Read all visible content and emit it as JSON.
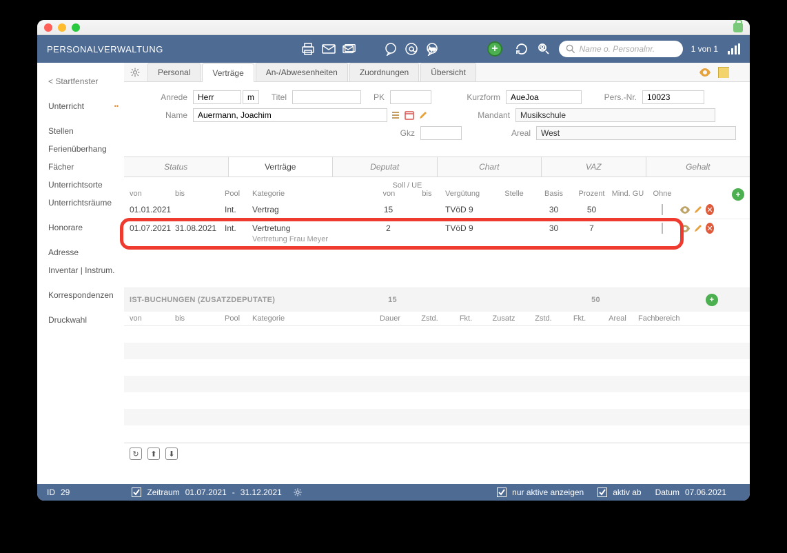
{
  "app": {
    "title": "PERSONALVERWALTUNG",
    "search_placeholder": "Name o. Personalnr.",
    "page_info": "1 von 1"
  },
  "tabs": {
    "items": [
      "Personal",
      "Verträge",
      "An-/Abwesenheiten",
      "Zuordnungen",
      "Übersicht"
    ],
    "active": 1
  },
  "sidebar": {
    "back": "< Startfenster",
    "items": [
      "Unterricht",
      "Stellen",
      "Ferienüberhang",
      "Fächer",
      "Unterrichtsorte",
      "Unterrichtsräume",
      "Honorare",
      "Adresse",
      "Inventar | Instrum.",
      "Korrespondenzen",
      "Druckwahl"
    ]
  },
  "form": {
    "anrede_label": "Anrede",
    "anrede": "Herr",
    "gender": "m",
    "titel_label": "Titel",
    "titel": "",
    "pk_label": "PK",
    "pk": "",
    "name_label": "Name",
    "name": "Auermann, Joachim",
    "gkz_label": "Gkz",
    "gkz": "",
    "kurzform_label": "Kurzform",
    "kurzform": "AueJoa",
    "persnr_label": "Pers.-Nr.",
    "persnr": "10023",
    "mandant_label": "Mandant",
    "mandant": "Musikschule",
    "areal_label": "Areal",
    "areal": "West"
  },
  "subtabs": {
    "items": [
      "Status",
      "Verträge",
      "Deputat",
      "Chart",
      "VAZ",
      "Gehalt"
    ],
    "active": 1
  },
  "contracts": {
    "headers": {
      "von": "von",
      "bis": "bis",
      "pool": "Pool",
      "kategorie": "Kategorie",
      "soll": "Soll / UE",
      "soll_von": "von",
      "soll_bis": "bis",
      "verguetung": "Vergütung",
      "stelle": "Stelle",
      "basis": "Basis",
      "prozent": "Prozent",
      "mindgu": "Mind. GU",
      "ohne": "Ohne"
    },
    "rows": [
      {
        "von": "01.01.2021",
        "bis": "",
        "pool": "Int.",
        "kategorie": "Vertrag",
        "soll_von": "15",
        "soll_bis": "",
        "verguetung": "TVöD 9",
        "stelle_icon": true,
        "basis": "30",
        "prozent": "50",
        "mindgu": "",
        "note": ""
      },
      {
        "von": "01.07.2021",
        "bis": "31.08.2021",
        "pool": "Int.",
        "kategorie": "Vertretung",
        "soll_von": "2",
        "soll_bis": "",
        "verguetung": "TVöD 9",
        "stelle_icon": true,
        "basis": "30",
        "prozent": "7",
        "mindgu": "",
        "note": "Vertretung Frau Meyer",
        "highlighted": true
      }
    ]
  },
  "ist": {
    "title": "IST-BUCHUNGEN (ZUSATZDEPUTATE)",
    "sum_dauer": "15",
    "sum_prozent": "50",
    "headers": {
      "von": "von",
      "bis": "bis",
      "pool": "Pool",
      "kategorie": "Kategorie",
      "dauer": "Dauer",
      "zstd": "Zstd.",
      "fkt": "Fkt.",
      "zusatz": "Zusatz",
      "zstd2": "Zstd.",
      "fkt2": "Fkt.",
      "areal": "Areal",
      "fachbereich": "Fachbereich"
    }
  },
  "footer": {
    "id_label": "ID",
    "id": "29",
    "zeitraum_label": "Zeitraum",
    "zeitraum_von": "01.07.2021",
    "zeitraum_sep": "-",
    "zeitraum_bis": "31.12.2021",
    "nur_aktive": "nur aktive anzeigen",
    "aktiv_ab": "aktiv ab",
    "datum_label": "Datum",
    "datum": "07.06.2021"
  }
}
